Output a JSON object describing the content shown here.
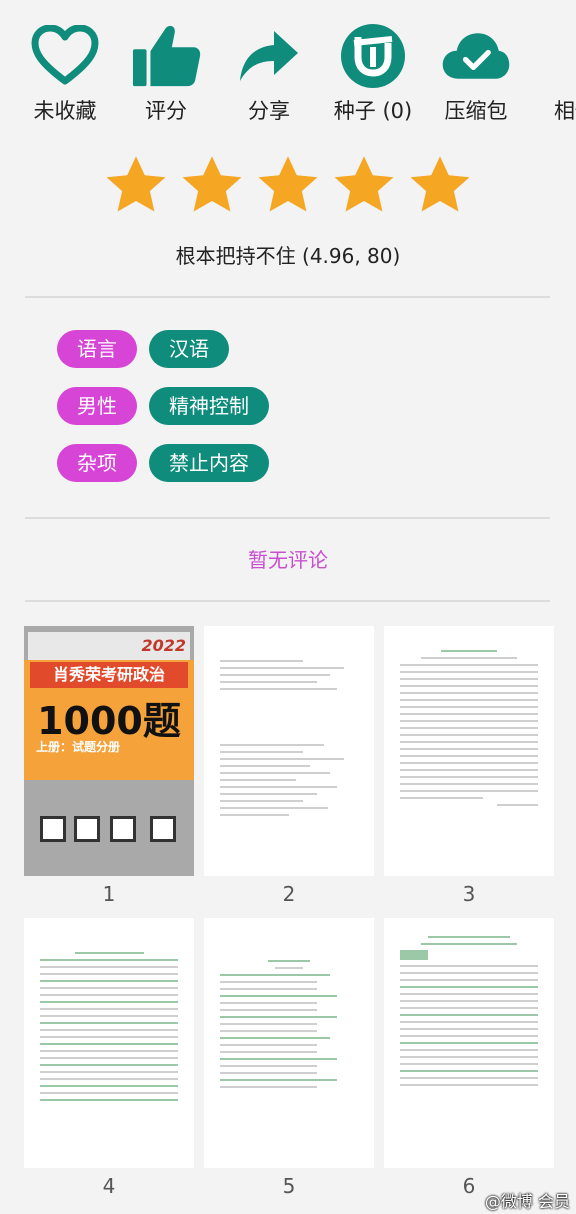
{
  "actions": [
    {
      "label": "未收藏",
      "icon": "heart-outline-icon"
    },
    {
      "label": "评分",
      "icon": "thumbs-up-icon"
    },
    {
      "label": "分享",
      "icon": "share-arrow-icon"
    },
    {
      "label": "种子 (0)",
      "icon": "torrent-icon"
    },
    {
      "label": "压缩包",
      "icon": "cloud-check-icon"
    },
    {
      "label": "相似",
      "icon": "similar-icon"
    }
  ],
  "rating": {
    "stars": 5,
    "max_stars": 5,
    "text": "根本把持不住 (4.96, 80)"
  },
  "tags": [
    {
      "key": "语言",
      "values": [
        "汉语"
      ]
    },
    {
      "key": "男性",
      "values": [
        "精神控制"
      ]
    },
    {
      "key": "杂项",
      "values": [
        "禁止内容"
      ]
    }
  ],
  "comments": {
    "empty_text": "暂无评论"
  },
  "thumbnails": [
    {
      "number": "1"
    },
    {
      "number": "2"
    },
    {
      "number": "3"
    },
    {
      "number": "4"
    },
    {
      "number": "5"
    },
    {
      "number": "6"
    }
  ],
  "cover": {
    "title": "肖秀荣考研政治",
    "big": "1000题",
    "sub": "上册：试题分册",
    "year": "2022"
  },
  "watermark": "@微博 会员",
  "colors": {
    "accent": "#0f8c7c",
    "star": "#f5a623",
    "tag_key": "#d645d6",
    "tag_value": "#0f8c7c",
    "empty_comment": "#c84fd0"
  }
}
